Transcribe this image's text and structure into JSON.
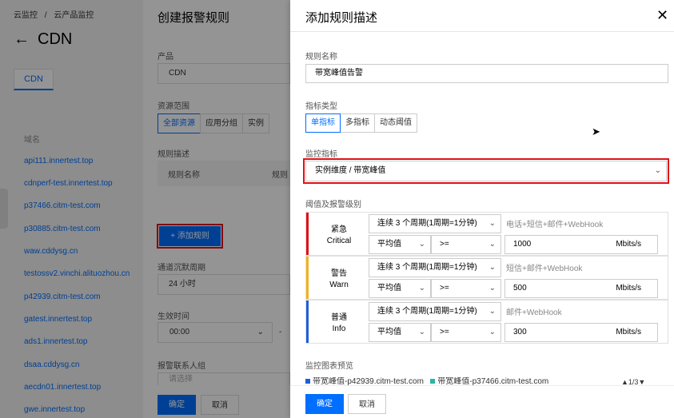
{
  "background": {
    "breadcrumb": [
      "云监控",
      "/",
      "云产品监控"
    ],
    "title": "CDN",
    "tab": "CDN",
    "column_header": "域名",
    "domains": [
      "api111.innertest.top",
      "cdnperf-test.innertest.top",
      "p37466.citm-test.com",
      "p30885.citm-test.com",
      "waw.cddysg.cn",
      "testossv2.vinchi.alituozhou.cn",
      "p42939.citm-test.com",
      "gatest.innertest.top",
      "ads1.innertest.top",
      "dsaa.cddysg.cn",
      "aecdn01.innertest.top",
      "gwe.innertest.top"
    ]
  },
  "middle": {
    "title": "创建报警规则",
    "product_label": "产品",
    "product_value": "CDN",
    "scope_label": "资源范围",
    "scope_options": [
      "全部资源",
      "应用分组",
      "实例"
    ],
    "rule_desc_label": "规则描述",
    "table_headers": [
      "规则名称",
      "规则"
    ],
    "add_rule": "+ 添加规则",
    "silence_label": "通道沉默周期",
    "silence_value": "24 小时",
    "effective_label": "生效时间",
    "effective_value": "00:00",
    "dash": "-",
    "contacts_label": "报警联系人组",
    "contacts_placeholder": "请选择",
    "confirm": "确定",
    "cancel": "取消"
  },
  "drawer": {
    "title": "添加规则描述",
    "close": "✕",
    "rule_name_label": "规则名称",
    "rule_name_value": "带宽峰值告警",
    "metric_type_label": "指标类型",
    "metric_types": [
      "单指标",
      "多指标",
      "动态阈值"
    ],
    "monitor_metric_label": "监控指标",
    "monitor_metric_value": "实例维度 / 带宽峰值",
    "threshold_label": "阈值及报警级别",
    "levels": [
      {
        "name": "紧急",
        "en": "Critical",
        "color": "#e0101a",
        "period": "连续 3 个周期(1周期=1分钟)",
        "notify": "电话+短信+邮件+WebHook",
        "stat": "平均值",
        "op": ">=",
        "value": "1000",
        "unit": "Mbits/s"
      },
      {
        "name": "警告",
        "en": "Warn",
        "color": "#f5b21e",
        "period": "连续 3 个周期(1周期=1分钟)",
        "notify": "短信+邮件+WebHook",
        "stat": "平均值",
        "op": ">=",
        "value": "500",
        "unit": "Mbits/s"
      },
      {
        "name": "普通",
        "en": "Info",
        "color": "#1e5fd7",
        "period": "连续 3 个周期(1周期=1分钟)",
        "notify": "邮件+WebHook",
        "stat": "平均值",
        "op": ">=",
        "value": "300",
        "unit": "Mbits/s"
      }
    ],
    "chart_preview_label": "监控图表预览",
    "legend": [
      {
        "name": "带宽峰值-p42939.citm-test.com",
        "color": "#1e5fd7"
      },
      {
        "name": "带宽峰值-p37466.citm-test.com",
        "color": "#2bb5a5"
      }
    ],
    "pager": "▲1/3▼",
    "confirm": "确定",
    "cancel": "取消"
  }
}
